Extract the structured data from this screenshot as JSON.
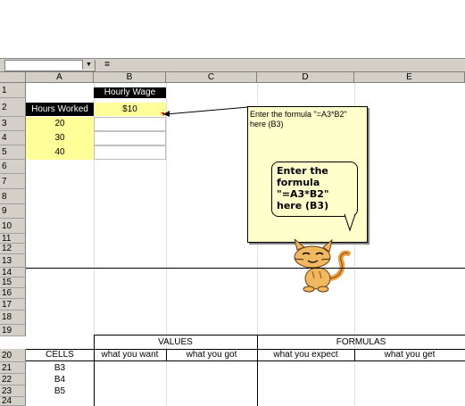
{
  "formula_bar": {
    "equals": "="
  },
  "columns": [
    "A",
    "B",
    "C",
    "D",
    "E"
  ],
  "rows": [
    "1",
    "2",
    "3",
    "4",
    "5",
    "6",
    "7",
    "8",
    "9",
    "10",
    "11",
    "12",
    "13",
    "14",
    "15",
    "16",
    "17",
    "18",
    "19",
    "20",
    "21",
    "22",
    "23",
    "24"
  ],
  "cells": {
    "B1": "Hourly Wage",
    "A2": "Hours Worked",
    "B2": "$10",
    "A3": "20",
    "A4": "30",
    "A5": "40",
    "B19": "VALUES",
    "D19": "FORMULAS",
    "A20": "CELLS",
    "B20": "what you want",
    "C20": "what you got",
    "D20": "what you expect",
    "E20": "what you get",
    "A21": "B3",
    "A22": "B4",
    "A23": "B5"
  },
  "comment_note": "Enter the formula \"=A3*B2\" here (B3)",
  "assistant_bubble": "Enter the formula \"=A3*B2\" here (B3)",
  "assistant_icon": "cat-icon"
}
